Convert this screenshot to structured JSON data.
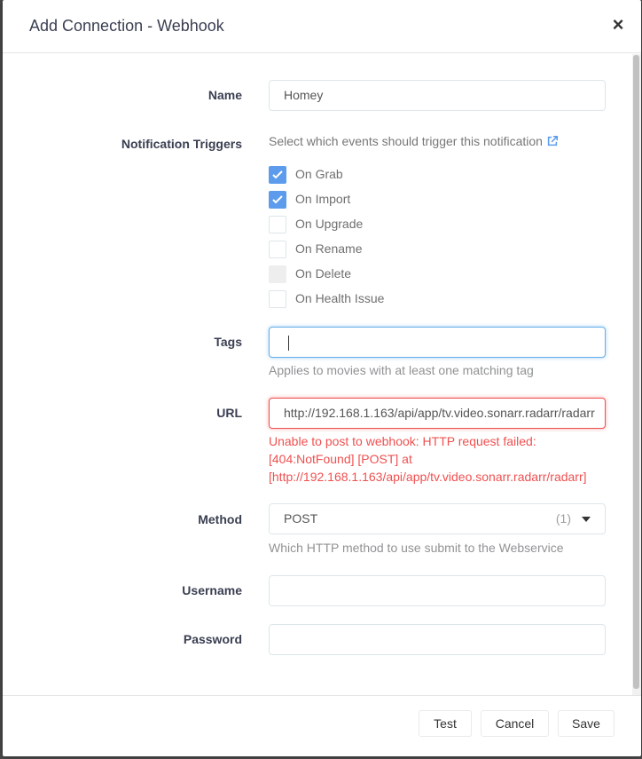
{
  "modal": {
    "title": "Add Connection - Webhook",
    "close_glyph": "×"
  },
  "form": {
    "name": {
      "label": "Name",
      "value": "Homey"
    },
    "triggers": {
      "label": "Notification Triggers",
      "help": "Select which events should trigger this notification",
      "items": [
        {
          "label": "On Grab",
          "checked": true,
          "disabled": false
        },
        {
          "label": "On Import",
          "checked": true,
          "disabled": false
        },
        {
          "label": "On Upgrade",
          "checked": false,
          "disabled": false
        },
        {
          "label": "On Rename",
          "checked": false,
          "disabled": false
        },
        {
          "label": "On Delete",
          "checked": false,
          "disabled": true
        },
        {
          "label": "On Health Issue",
          "checked": false,
          "disabled": false
        }
      ]
    },
    "tags": {
      "label": "Tags",
      "value": "",
      "help": "Applies to movies with at least one matching tag"
    },
    "url": {
      "label": "URL",
      "value": "http://192.168.1.163/api/app/tv.video.sonarr.radarr/radarr",
      "error_lines": [
        "Unable to post to webhook: HTTP request failed:",
        "[404:NotFound] [POST] at",
        "[http://192.168.1.163/api/app/tv.video.sonarr.radarr/radarr]"
      ]
    },
    "method": {
      "label": "Method",
      "value": "POST",
      "count": "(1)",
      "help": "Which HTTP method to use submit to the Webservice"
    },
    "username": {
      "label": "Username",
      "value": ""
    },
    "password": {
      "label": "Password",
      "value": ""
    }
  },
  "footer": {
    "test_label": "Test",
    "cancel_label": "Cancel",
    "save_label": "Save"
  },
  "colors": {
    "accent": "#5d9cec",
    "error": "#f05050",
    "focus": "#66afe9"
  },
  "icons": {
    "external_link": "external-link-icon",
    "close": "close-icon",
    "check": "check-icon",
    "caret": "caret-down-icon"
  }
}
